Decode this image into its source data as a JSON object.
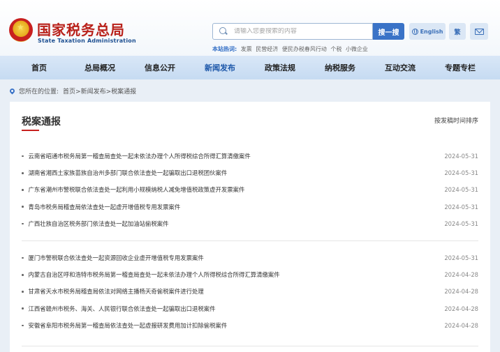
{
  "header": {
    "logo_cn": "国家税务总局",
    "logo_en": "State Taxation Administration",
    "search_placeholder": "请输入您要搜索的内容",
    "search_button": "搜一搜",
    "hot_label": "本站热词:",
    "hot_words": [
      "发票",
      "民营经济",
      "便民办税春风行动",
      "个税",
      "小微企业"
    ],
    "lang_label": "English",
    "trad_label": "繁"
  },
  "nav": {
    "items": [
      "首页",
      "总局概况",
      "信息公开",
      "新闻发布",
      "政策法规",
      "纳税服务",
      "互动交流",
      "专题专栏"
    ],
    "active_index": 3
  },
  "breadcrumb": {
    "prefix": "您所在的位置:",
    "path": "首页>新闻发布>税案通报"
  },
  "card": {
    "title": "税案通报",
    "sort_label": "按发稿时间排序"
  },
  "news_group_1": [
    {
      "title": "云南省昭通市税务局第一稽查局查处一起未依法办理个人所得税综合所得汇算清缴案件",
      "date": "2024-05-31"
    },
    {
      "title": "湖南省湘西土家族苗族自治州多部门联合依法查处一起骗取出口退税团伙案件",
      "date": "2024-05-31"
    },
    {
      "title": "广东省潮州市警税联合依法查处一起利用小规模纳税人减免增值税政策虚开发票案件",
      "date": "2024-05-31"
    },
    {
      "title": "青岛市税务局稽查局依法查处一起虚开增值税专用发票案件",
      "date": "2024-05-31"
    },
    {
      "title": "广西壮族自治区税务部门依法查处一起加油站偷税案件",
      "date": "2024-05-31"
    }
  ],
  "news_group_2": [
    {
      "title": "厦门市警税联合依法查处一起资源回收企业虚开增值税专用发票案件",
      "date": "2024-05-31"
    },
    {
      "title": "内蒙古自治区呼和浩特市税务局第一稽查局查处一起未依法办理个人所得税综合所得汇算清缴案件",
      "date": "2024-04-28"
    },
    {
      "title": "甘肃省天水市税务局稽查局依法对网络主播杨天奇偷税案件进行处理",
      "date": "2024-04-28"
    },
    {
      "title": "江西省赣州市税务、海关、人民银行联合依法查处一起骗取出口退税案件",
      "date": "2024-04-28"
    },
    {
      "title": "安徽省阜阳市税务局第一稽查局依法查处一起虚报研发费用加计扣除偷税案件",
      "date": "2024-04-28"
    }
  ]
}
